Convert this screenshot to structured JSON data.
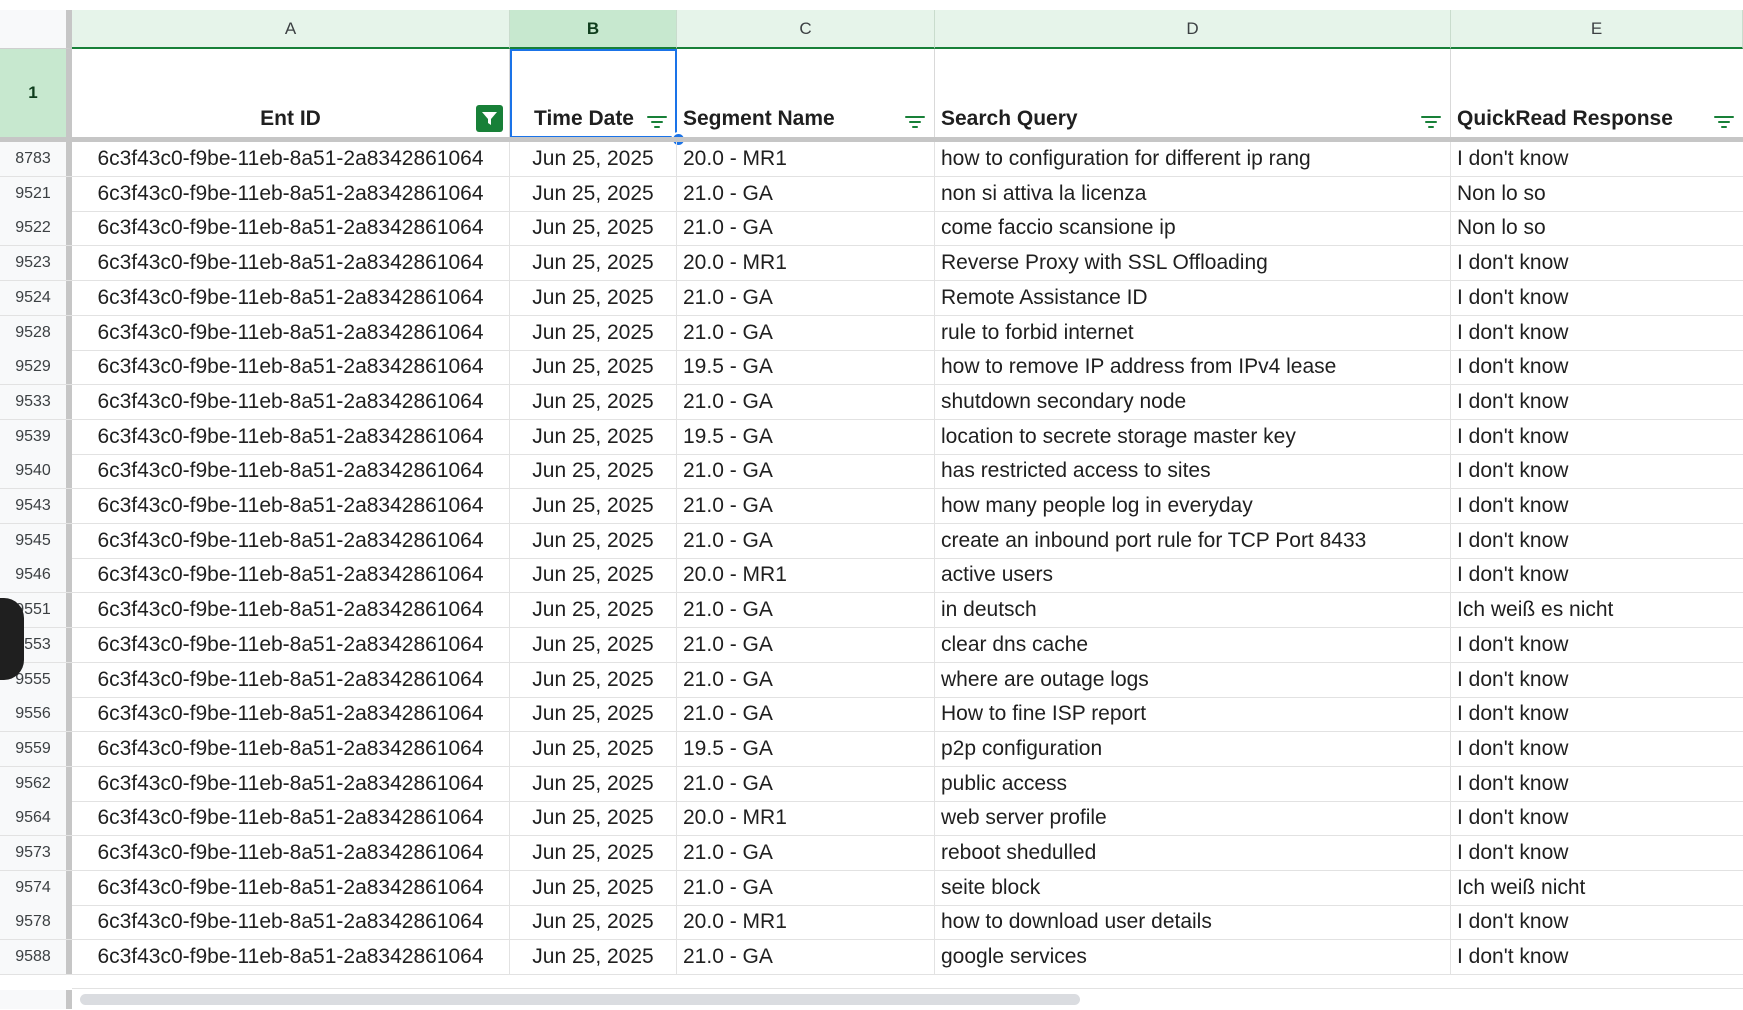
{
  "columns": {
    "a": "A",
    "b": "B",
    "c": "C",
    "d": "D",
    "e": "E"
  },
  "header_row_number": "1",
  "headers": {
    "a": "Ent ID",
    "b": "Time Date",
    "c": "Segment Name",
    "d": "Search Query",
    "e": "QuickRead Response"
  },
  "icons": {
    "filter": "filter-lines-icon",
    "filter_active": "filter-funnel-active-icon"
  },
  "colors": {
    "selection": "#1a73e8",
    "header_green": "#e6f4ea",
    "selected_header": "#c7e8cf",
    "filter_active": "#188038"
  },
  "rows": [
    {
      "num": "8783",
      "ent": "6c3f43c0-f9be-11eb-8a51-2a8342861064",
      "date": "Jun 25, 2025",
      "segment": "20.0 - MR1",
      "query": "how to configuration for different ip rang",
      "response": "I don't know"
    },
    {
      "num": "9521",
      "ent": "6c3f43c0-f9be-11eb-8a51-2a8342861064",
      "date": "Jun 25, 2025",
      "segment": "21.0 - GA",
      "query": "non si attiva la licenza",
      "response": "Non lo so"
    },
    {
      "num": "9522",
      "ent": "6c3f43c0-f9be-11eb-8a51-2a8342861064",
      "date": "Jun 25, 2025",
      "segment": "21.0 - GA",
      "query": "come faccio scansione ip",
      "response": "Non lo so"
    },
    {
      "num": "9523",
      "ent": "6c3f43c0-f9be-11eb-8a51-2a8342861064",
      "date": "Jun 25, 2025",
      "segment": "20.0 - MR1",
      "query": "Reverse Proxy with SSL Offloading",
      "response": "I don't know"
    },
    {
      "num": "9524",
      "ent": "6c3f43c0-f9be-11eb-8a51-2a8342861064",
      "date": "Jun 25, 2025",
      "segment": "21.0 - GA",
      "query": "Remote Assistance ID",
      "response": "I don't know"
    },
    {
      "num": "9528",
      "ent": "6c3f43c0-f9be-11eb-8a51-2a8342861064",
      "date": "Jun 25, 2025",
      "segment": "21.0 - GA",
      "query": "rule to forbid internet",
      "response": "I don't know"
    },
    {
      "num": "9529",
      "ent": "6c3f43c0-f9be-11eb-8a51-2a8342861064",
      "date": "Jun 25, 2025",
      "segment": "19.5 - GA",
      "query": "how to remove IP address from IPv4 lease",
      "response": "I don't know"
    },
    {
      "num": "9533",
      "ent": "6c3f43c0-f9be-11eb-8a51-2a8342861064",
      "date": "Jun 25, 2025",
      "segment": "21.0 - GA",
      "query": "shutdown secondary node",
      "response": "I don't know"
    },
    {
      "num": "9539",
      "ent": "6c3f43c0-f9be-11eb-8a51-2a8342861064",
      "date": "Jun 25, 2025",
      "segment": "19.5 - GA",
      "query": "location to secrete storage master key",
      "response": "I don't know"
    },
    {
      "num": "9540",
      "ent": "6c3f43c0-f9be-11eb-8a51-2a8342861064",
      "date": "Jun 25, 2025",
      "segment": "21.0 - GA",
      "query": "has restricted access to sites",
      "response": "I don't know"
    },
    {
      "num": "9543",
      "ent": "6c3f43c0-f9be-11eb-8a51-2a8342861064",
      "date": "Jun 25, 2025",
      "segment": "21.0 - GA",
      "query": "how many people log in everyday",
      "response": "I don't know"
    },
    {
      "num": "9545",
      "ent": "6c3f43c0-f9be-11eb-8a51-2a8342861064",
      "date": "Jun 25, 2025",
      "segment": "21.0 - GA",
      "query": "create an inbound port rule for TCP Port 8433",
      "response": "I don't know"
    },
    {
      "num": "9546",
      "ent": "6c3f43c0-f9be-11eb-8a51-2a8342861064",
      "date": "Jun 25, 2025",
      "segment": "20.0 - MR1",
      "query": "active users",
      "response": "I don't know"
    },
    {
      "num": "9551",
      "ent": "6c3f43c0-f9be-11eb-8a51-2a8342861064",
      "date": "Jun 25, 2025",
      "segment": "21.0 - GA",
      "query": "in deutsch",
      "response": "Ich weiß es nicht"
    },
    {
      "num": "9553",
      "ent": "6c3f43c0-f9be-11eb-8a51-2a8342861064",
      "date": "Jun 25, 2025",
      "segment": "21.0 - GA",
      "query": "clear dns cache",
      "response": "I don't know"
    },
    {
      "num": "9555",
      "ent": "6c3f43c0-f9be-11eb-8a51-2a8342861064",
      "date": "Jun 25, 2025",
      "segment": "21.0 - GA",
      "query": "where are outage logs",
      "response": "I don't know"
    },
    {
      "num": "9556",
      "ent": "6c3f43c0-f9be-11eb-8a51-2a8342861064",
      "date": "Jun 25, 2025",
      "segment": "21.0 - GA",
      "query": "How to fine ISP report",
      "response": "I don't know"
    },
    {
      "num": "9559",
      "ent": "6c3f43c0-f9be-11eb-8a51-2a8342861064",
      "date": "Jun 25, 2025",
      "segment": "19.5 - GA",
      "query": "p2p configuration",
      "response": "I don't know"
    },
    {
      "num": "9562",
      "ent": "6c3f43c0-f9be-11eb-8a51-2a8342861064",
      "date": "Jun 25, 2025",
      "segment": "21.0 - GA",
      "query": "public access",
      "response": "I don't know"
    },
    {
      "num": "9564",
      "ent": "6c3f43c0-f9be-11eb-8a51-2a8342861064",
      "date": "Jun 25, 2025",
      "segment": "20.0 - MR1",
      "query": "web server profile",
      "response": "I don't know"
    },
    {
      "num": "9573",
      "ent": "6c3f43c0-f9be-11eb-8a51-2a8342861064",
      "date": "Jun 25, 2025",
      "segment": "21.0 - GA",
      "query": "reboot shedulled",
      "response": "I don't know"
    },
    {
      "num": "9574",
      "ent": "6c3f43c0-f9be-11eb-8a51-2a8342861064",
      "date": "Jun 25, 2025",
      "segment": "21.0 - GA",
      "query": "seite block",
      "response": "Ich weiß nicht"
    },
    {
      "num": "9578",
      "ent": "6c3f43c0-f9be-11eb-8a51-2a8342861064",
      "date": "Jun 25, 2025",
      "segment": "20.0 - MR1",
      "query": "how to download user details",
      "response": "I don't know"
    },
    {
      "num": "9588",
      "ent": "6c3f43c0-f9be-11eb-8a51-2a8342861064",
      "date": "Jun 25, 2025",
      "segment": "21.0 - GA",
      "query": "google services",
      "response": "I don't know"
    }
  ]
}
